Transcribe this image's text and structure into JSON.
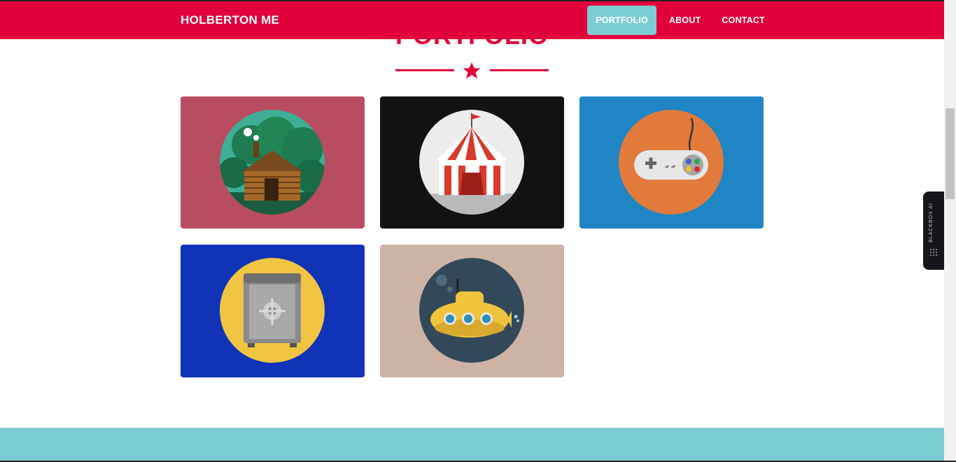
{
  "navbar": {
    "brand": "HOLBERTON ME",
    "items": [
      {
        "label": "PORTFOLIO",
        "active": true
      },
      {
        "label": "ABOUT",
        "active": false
      },
      {
        "label": "CONTACT",
        "active": false
      }
    ]
  },
  "portfolio": {
    "title": "PORTFOLIO",
    "items": [
      {
        "icon": "log-cabin-icon",
        "bg": "#b84d62"
      },
      {
        "icon": "circus-tent-icon",
        "bg": "#131111"
      },
      {
        "icon": "game-controller-icon",
        "bg": "#1f85c4"
      },
      {
        "icon": "safe-icon",
        "bg": "#1033b8"
      },
      {
        "icon": "submarine-icon",
        "bg": "#cdb3a6"
      }
    ]
  },
  "extension": {
    "label": "BLACKBOX AI"
  },
  "colors": {
    "accent": "#e1003b",
    "teal": "#7ccdd3"
  }
}
